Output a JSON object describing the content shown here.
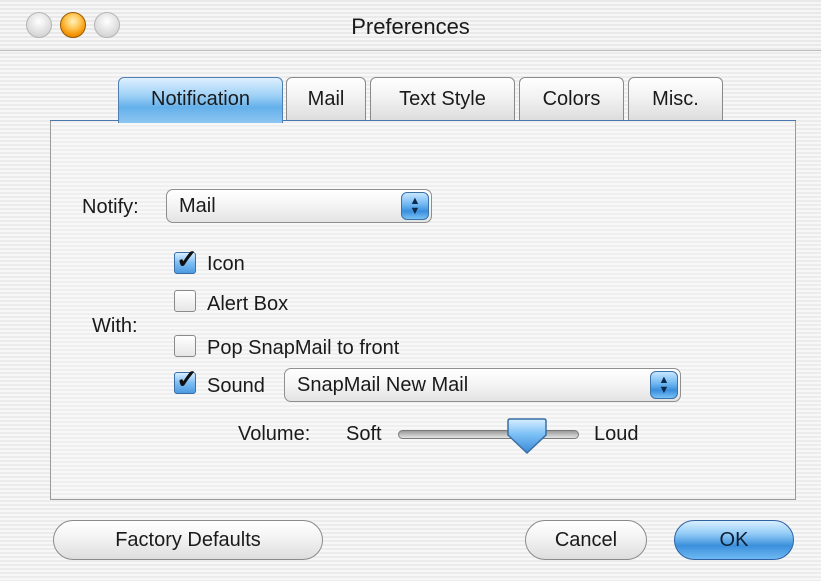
{
  "window": {
    "title": "Preferences"
  },
  "tabs": [
    {
      "label": "Notification",
      "active": true
    },
    {
      "label": "Mail",
      "active": false
    },
    {
      "label": "Text Style",
      "active": false
    },
    {
      "label": "Colors",
      "active": false
    },
    {
      "label": "Misc.",
      "active": false
    }
  ],
  "notify": {
    "label": "Notify:",
    "value": "Mail"
  },
  "with": {
    "label": "With:",
    "options": [
      {
        "label": "Icon",
        "checked": true
      },
      {
        "label": "Alert Box",
        "checked": false
      },
      {
        "label": "Pop SnapMail to front",
        "checked": false
      },
      {
        "label": "Sound",
        "checked": true
      }
    ],
    "sound_value": "SnapMail New Mail"
  },
  "volume": {
    "label": "Volume:",
    "min_label": "Soft",
    "max_label": "Loud",
    "level": 0.7
  },
  "buttons": {
    "factory_defaults": "Factory Defaults",
    "cancel": "Cancel",
    "ok": "OK"
  },
  "colors": {
    "accent": "#3b90dc",
    "active_tab": "#64b0ea"
  }
}
